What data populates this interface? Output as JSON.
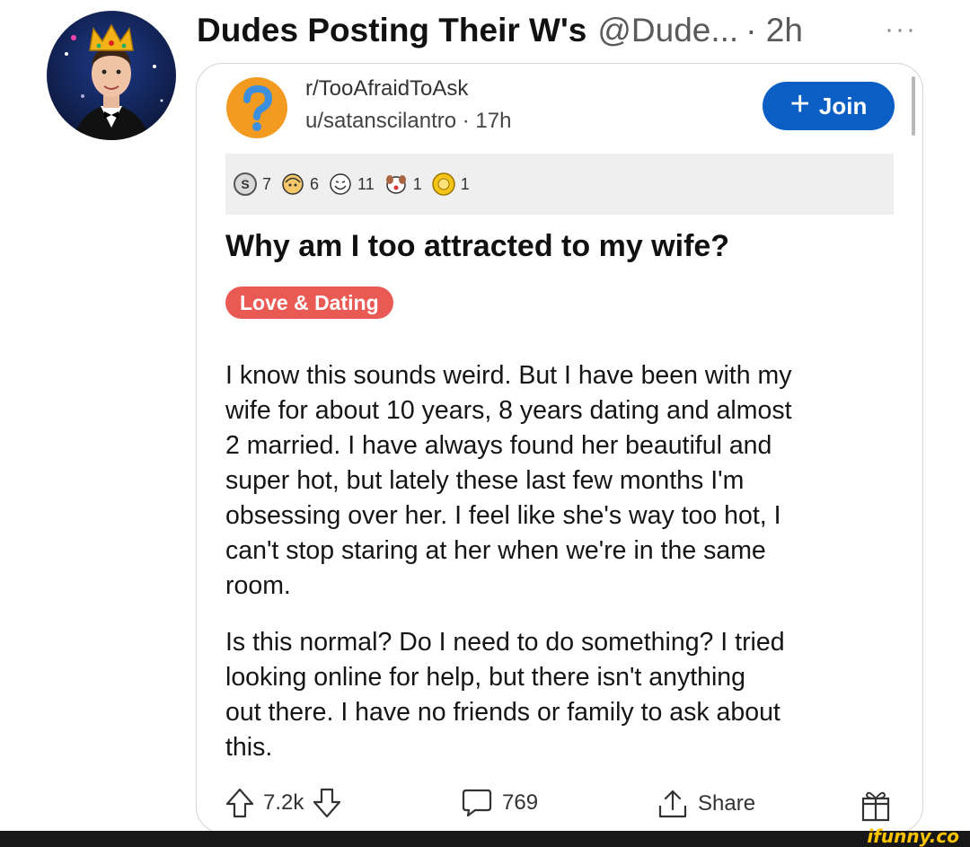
{
  "tweet": {
    "display_name": "Dudes Posting Their W's",
    "handle": "@Dude...",
    "time": "· 2h",
    "more": "···",
    "avatar_icon": "crowned-man-avatar"
  },
  "post": {
    "subreddit": "r/TooAfraidToAsk",
    "user_time": "u/satanscilantro · 17h",
    "join_label": "Join",
    "awards": [
      {
        "icon": "silver-award-icon",
        "count": "7"
      },
      {
        "icon": "wholesome-award-icon",
        "count": "6"
      },
      {
        "icon": "laugh-award-icon",
        "count": "11"
      },
      {
        "icon": "dog-award-icon",
        "count": "1"
      },
      {
        "icon": "gold-award-icon",
        "count": "1"
      }
    ],
    "title": "Why am I too attracted to my wife?",
    "flair": "Love & Dating",
    "body_paragraph_1": [
      "I know this sounds weird. But I have been with my",
      "wife for about 10 years, 8 years dating and almost",
      "2 married. I have always found her beautiful and",
      "super hot, but lately  these last few months I'm",
      "obsessing over her. I feel like she's way too hot, I",
      "can't stop staring at her when we're in the same",
      "room."
    ],
    "body_paragraph_2": [
      "Is this normal? Do I need to do something? I tried",
      "looking online for help, but there isn't anything",
      "out there. I have no friends or family to ask about",
      "this."
    ],
    "votes": "7.2k",
    "comments": "769",
    "share_label": "Share"
  },
  "watermark": "ifunny.co",
  "colors": {
    "join": "#0b5fc4",
    "flair": "#ea5a54",
    "watermark": "#ffc300"
  }
}
